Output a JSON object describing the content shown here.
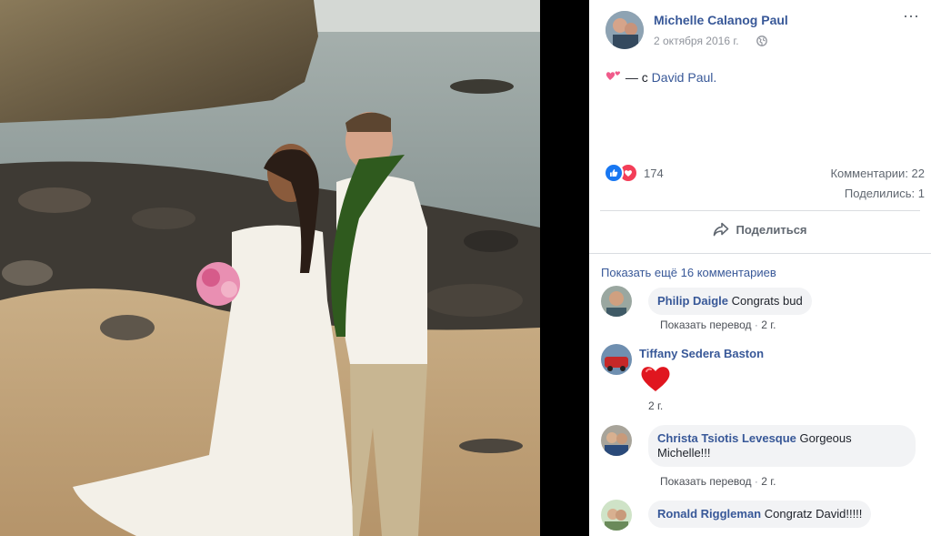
{
  "post": {
    "author": "Michelle Calanog Paul",
    "date": "2 октября 2016 г.",
    "caption_prefix": "— с",
    "tagged": "David Paul.",
    "reaction_count": "174",
    "comments_stat": "Комментарии: 22",
    "shares_stat": "Поделились: 1",
    "share_label": "Поделиться",
    "more_icon": "⋯"
  },
  "comments_section": {
    "show_more": "Показать ещё 16 комментариев",
    "items": [
      {
        "author": "Philip Daigle",
        "text": "Congrats bud",
        "translate": "Показать перевод",
        "time": "2 г."
      },
      {
        "author": "Tiffany Sedera Baston",
        "text": "",
        "time": "2 г."
      },
      {
        "author": "Christa Tsiotis Levesque",
        "text": "Gorgeous Michelle!!!",
        "translate": "Показать перевод",
        "time": "2 г."
      },
      {
        "author": "Ronald Riggleman",
        "text": "Congratz David!!!!!"
      }
    ]
  },
  "colors": {
    "link": "#385898",
    "like": "#1877f2",
    "love": "#f33e58",
    "heart": "#e0161f"
  }
}
